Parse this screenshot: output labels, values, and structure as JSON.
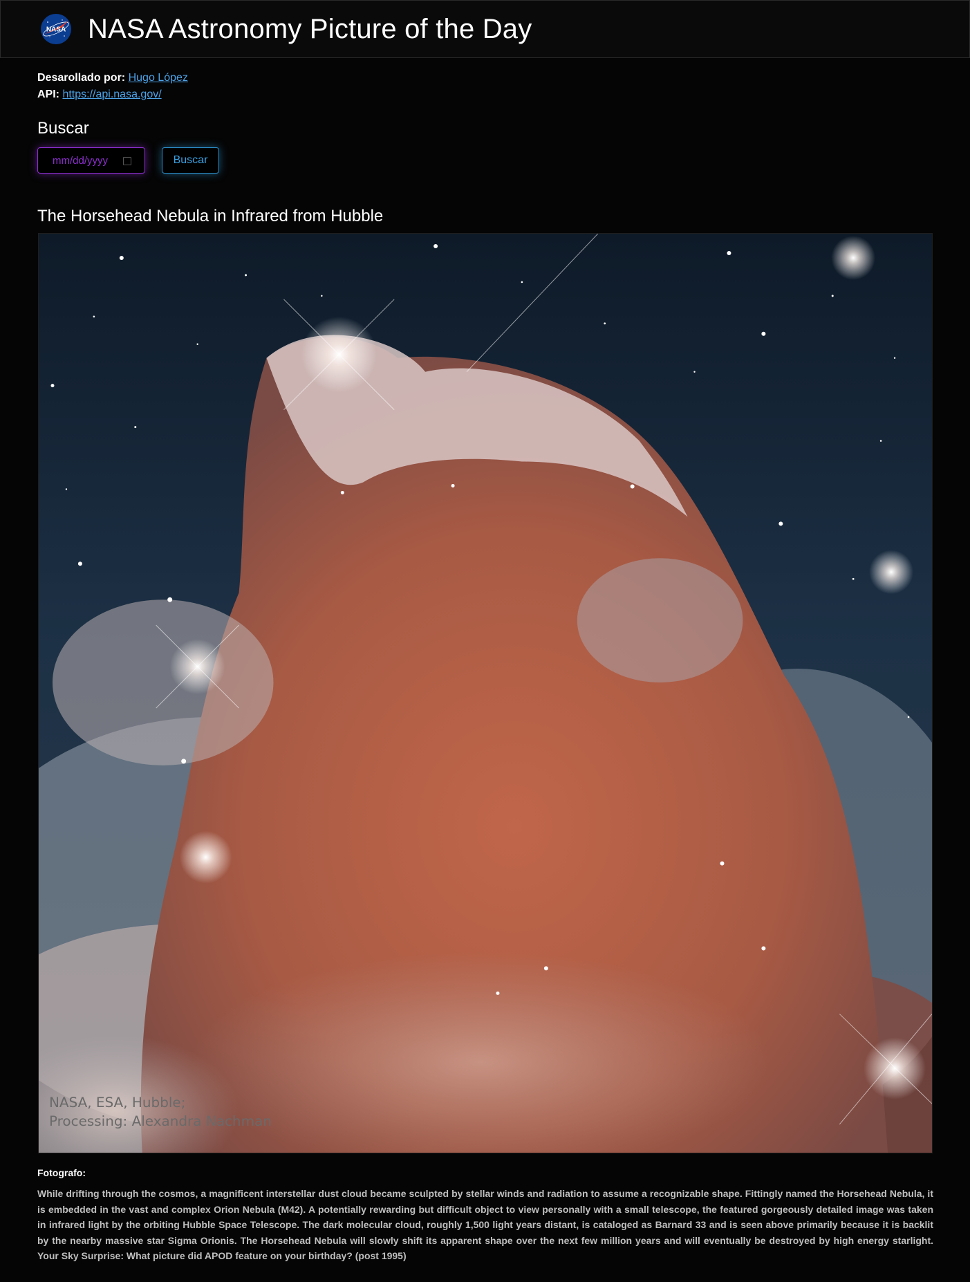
{
  "header": {
    "logo_text": "NASA",
    "title": "NASA Astronomy Picture of the Day"
  },
  "credits": {
    "developer_label": "Desarollado por:",
    "developer_name": "Hugo López",
    "api_label": "API:",
    "api_url": "https://api.nasa.gov/"
  },
  "search": {
    "heading": "Buscar",
    "date_placeholder": "mm/dd/yyyy",
    "button_label": "Buscar"
  },
  "picture": {
    "title": "The Horsehead Nebula in Infrared from Hubble",
    "image_credit_line1": "NASA, ESA, Hubble;",
    "image_credit_line2": "Processing: Alexandra Nachman",
    "photographer_label": "Fotografo:",
    "explanation": "While drifting through the cosmos, a magnificent interstellar dust cloud became sculpted by stellar winds and radiation to assume a recognizable shape. Fittingly named the Horsehead Nebula, it is embedded in the vast and complex Orion Nebula (M42). A potentially rewarding but difficult object to view personally with a small telescope, the featured gorgeously detailed image was taken in infrared light by the orbiting Hubble Space Telescope. The dark molecular cloud, roughly 1,500 light years distant, is cataloged as Barnard 33 and is seen above primarily because it is backlit by the nearby massive star Sigma Orionis. The Horsehead Nebula will slowly shift its apparent shape over the next few million years and will eventually be destroyed by high energy starlight. Your Sky Surprise: What picture did APOD feature on your birthday? (post 1995)"
  },
  "colors": {
    "link": "#4da3e8",
    "date_input_accent": "#8e2fd0",
    "button_accent": "#2c8ec8",
    "background": "#050505"
  }
}
